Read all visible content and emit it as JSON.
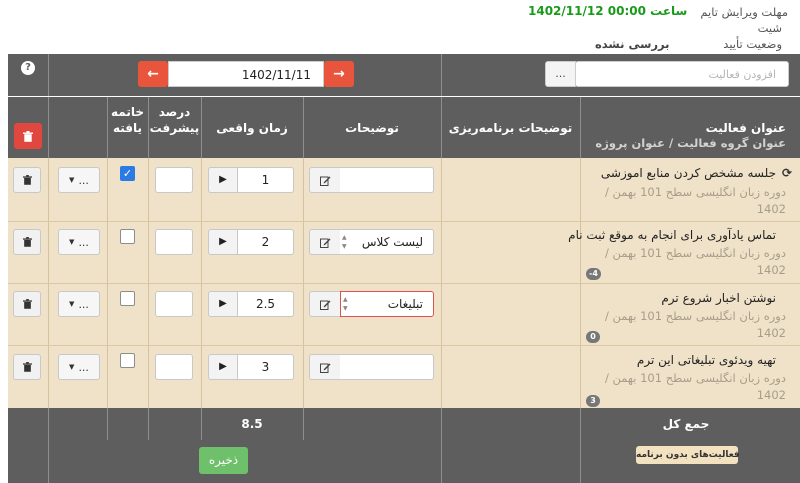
{
  "info": {
    "deadline_label": "مهلت ویرایش تایم",
    "shift_label": "شیت",
    "deadline_value": "1402/11/12 ساعت 00:00",
    "status_label": "وضعیت تأیید",
    "status_value": "بررسی نشده"
  },
  "toolbar": {
    "help": "?",
    "date": "1402/11/11",
    "prev": "←",
    "next": "→",
    "add_placeholder": "افزودن فعالیت",
    "add_button": "..."
  },
  "columns": {
    "finished_line1": "خاتمه",
    "finished_line2": "یافته",
    "progress_line1": "درصد",
    "progress_line2": "پیشرفت",
    "actual_time": "زمان واقعی",
    "description": "توضیحات",
    "planning_desc": "توضیحات برنامه‌ریزی",
    "activity_title": "عنوان فعالیت",
    "activity_group": "عنوان گروه فعالیت  / عنوان پروژه"
  },
  "rows": [
    {
      "title": "جلسه مشخص کردن منابع اموزشی",
      "subtitle": "/ دوره زبان انگلیسی سطح 101 بهمن 1402",
      "badge": "",
      "time": "1",
      "description": "",
      "progress": "",
      "finished": true,
      "menu": "...",
      "sync": "⟳"
    },
    {
      "title": "تماس یادآوری برای انجام به موقع ثبت نام",
      "subtitle": "/ دوره زبان انگلیسی سطح 101 بهمن 1402",
      "badge": "-4",
      "time": "2",
      "description": "لیست کلاس",
      "progress": "",
      "finished": false,
      "menu": "...",
      "sync": ""
    },
    {
      "title": "نوشتن اخبار شروع ترم",
      "subtitle": "/ دوره زبان انگلیسی سطح 101 بهمن 1402",
      "badge": "0",
      "time": "2.5",
      "description": "تبلیغات",
      "progress": "",
      "finished": false,
      "menu": "...",
      "sync": ""
    },
    {
      "title": "تهیه ویدئوی تبلیغاتی این ترم",
      "subtitle": "/ دوره زبان انگلیسی سطح 101 بهمن 1402",
      "badge": "3",
      "time": "3",
      "description": "",
      "progress": "",
      "finished": false,
      "menu": "...",
      "sync": ""
    }
  ],
  "footer": {
    "total_label": "جمع کل",
    "total_value": "8.5",
    "save": "ذخیره",
    "unplanned": "فعالیت‌های بدون برنامه"
  },
  "colors": {
    "header_bg": "#5e5e5e",
    "row_bg": "#efe2c8",
    "accent_red": "#e8553c",
    "save_green": "#6ec06a",
    "deadline_green": "#1a9a1a"
  },
  "icons": {
    "trash": "trash-icon",
    "edit": "edit-icon",
    "play": "play-icon",
    "sync": "refresh-icon",
    "caret": "caret-down-icon"
  }
}
